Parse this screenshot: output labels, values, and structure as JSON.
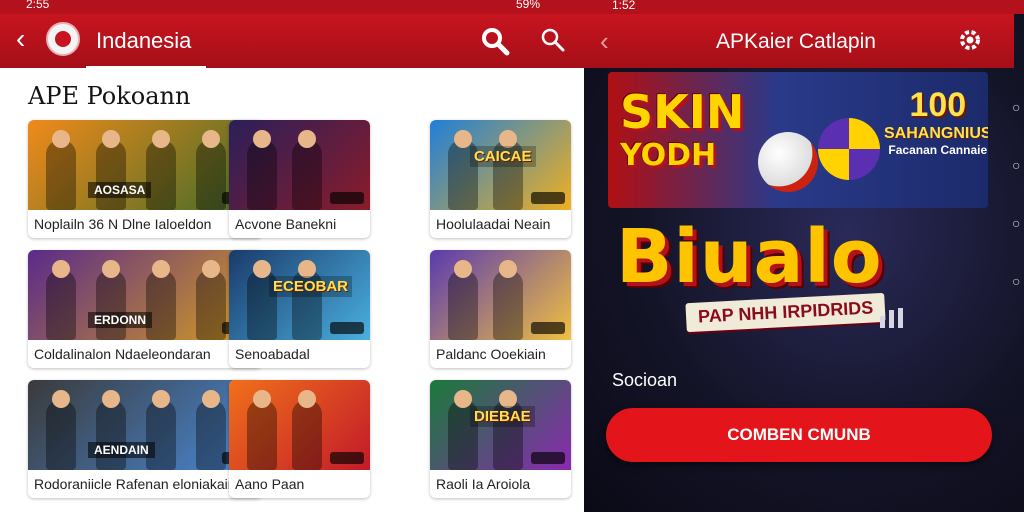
{
  "left_screen": {
    "status": {
      "time": "2:55",
      "battery": "59%"
    },
    "appbar": {
      "back_glyph": "‹",
      "title": "Indanesia"
    },
    "section_title": "APE Pokoann",
    "cards": [
      {
        "label": "Noplailn 36 N Dlne Ialoeldon",
        "badge": "AOSASA",
        "colors": [
          "#f08a1a",
          "#3c6b2a"
        ]
      },
      {
        "label": "Acvone Banekni",
        "badge": "",
        "colors": [
          "#2a1f5a",
          "#8a1c2a"
        ]
      },
      {
        "label": "Hoolulaadai Neain",
        "badge": "",
        "banner": "CAICAE",
        "colors": [
          "#1f7fd8",
          "#f0b020"
        ]
      },
      {
        "label": "Coldalinalon Ndaeleondaran",
        "badge": "ERDONN",
        "colors": [
          "#5a2a8a",
          "#d8a020"
        ]
      },
      {
        "label": "Senoabadal",
        "badge": "",
        "banner": "ECEOBAR",
        "colors": [
          "#1a3a6a",
          "#4ab0e0"
        ]
      },
      {
        "label": "Paldanc Ooekiain",
        "badge": "",
        "colors": [
          "#5a3ab0",
          "#f0c040"
        ]
      },
      {
        "label": "Rodoraniicle Rafenan eloniakain",
        "badge": "AENDAIN",
        "colors": [
          "#3a3a3a",
          "#4a8ad8"
        ]
      },
      {
        "label": "Aano Paan",
        "badge": "",
        "colors": [
          "#f0701a",
          "#c21a2a"
        ]
      },
      {
        "label": "Raoli Ia Aroiola",
        "badge": "",
        "banner": "DIEBAE",
        "colors": [
          "#1a7a3a",
          "#8a2ab0"
        ]
      }
    ]
  },
  "right_screen": {
    "status": {
      "time": "1:52"
    },
    "appbar": {
      "back_glyph": "‹",
      "title": "APKaier Catlapin"
    },
    "hero_banner": {
      "left_top": "SKIN",
      "left_bottom": "YODH",
      "right_number": "100",
      "right_line1": "SAHANGNIUS",
      "right_line2": "Facanan Cannaie"
    },
    "logo_text": "Biualo",
    "tagline": "PAP NHH IRPIDRIDS",
    "description": "Socioan",
    "cta_label": "COMBEN CMUNB"
  }
}
